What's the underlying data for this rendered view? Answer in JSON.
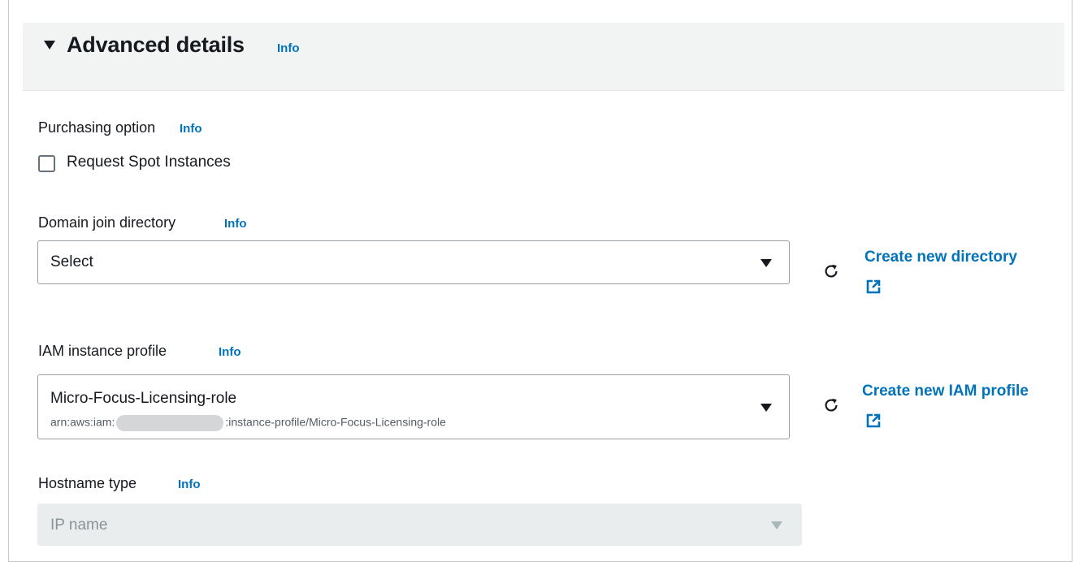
{
  "section": {
    "title": "Advanced details",
    "info": "Info"
  },
  "purchasing": {
    "label": "Purchasing option",
    "info": "Info",
    "checkbox_label": "Request Spot Instances",
    "checked": false
  },
  "domain": {
    "label": "Domain join directory",
    "info": "Info",
    "selected": "Select",
    "create_link": "Create new directory"
  },
  "iam": {
    "label": "IAM instance profile",
    "info": "Info",
    "selected": "Micro-Focus-Licensing-role",
    "arn_prefix": "arn:aws:iam:",
    "arn_suffix": ":instance-profile/Micro-Focus-Licensing-role",
    "create_link": "Create new IAM profile"
  },
  "hostname": {
    "label": "Hostname type",
    "info": "Info",
    "selected": "IP name",
    "disabled": true
  },
  "icons": {
    "caret": "caret-down-icon",
    "dropdown": "dropdown-arrow-icon",
    "refresh": "refresh-icon",
    "external": "external-link-icon"
  },
  "colors": {
    "link": "#0073bb",
    "header_bg": "#f2f3f3",
    "disabled_bg": "#eaeded"
  }
}
